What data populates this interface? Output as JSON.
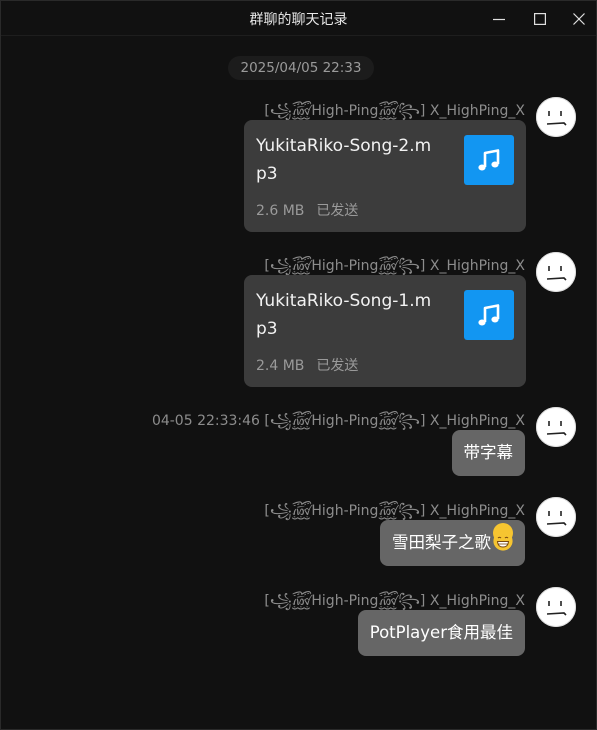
{
  "window": {
    "title": "群聊的聊天记录"
  },
  "titlebar_icons": {
    "minimize": "minimize-icon",
    "maximize": "maximize-icon",
    "close": "close-icon"
  },
  "chat": {
    "timestamp": "2025/04/05 22:33",
    "messages": [
      {
        "type": "file",
        "sender": "[꧁꫞High-Ping꫞꧂] X_HighPing_X",
        "file_name": "YukitaRiko-Song-2.mp3",
        "file_size": "2.6 MB",
        "status": "已发送",
        "icon": "music-note-icon"
      },
      {
        "type": "file",
        "sender": "[꧁꫞High-Ping꫞꧂] X_HighPing_X",
        "file_name": "YukitaRiko-Song-1.mp3",
        "file_size": "2.4 MB",
        "status": "已发送",
        "icon": "music-note-icon"
      },
      {
        "type": "text",
        "sender": "04-05 22:33:46 [꧁꫞High-Ping꫞꧂] X_HighPing_X",
        "text": "带字幕"
      },
      {
        "type": "text",
        "sender": "[꧁꫞High-Ping꫞꧂] X_HighPing_X",
        "text": "雪田梨子之歌",
        "emoji": "grinning-face-emoji"
      },
      {
        "type": "text",
        "sender": "[꧁꫞High-Ping꫞꧂] X_HighPing_X",
        "text": "PotPlayer食用最佳"
      }
    ]
  },
  "colors": {
    "background": "#111111",
    "bubble": "#666666",
    "file_card": "#3c3c3c",
    "file_icon": "#1296f2",
    "sender_text": "#8c8c8c"
  }
}
